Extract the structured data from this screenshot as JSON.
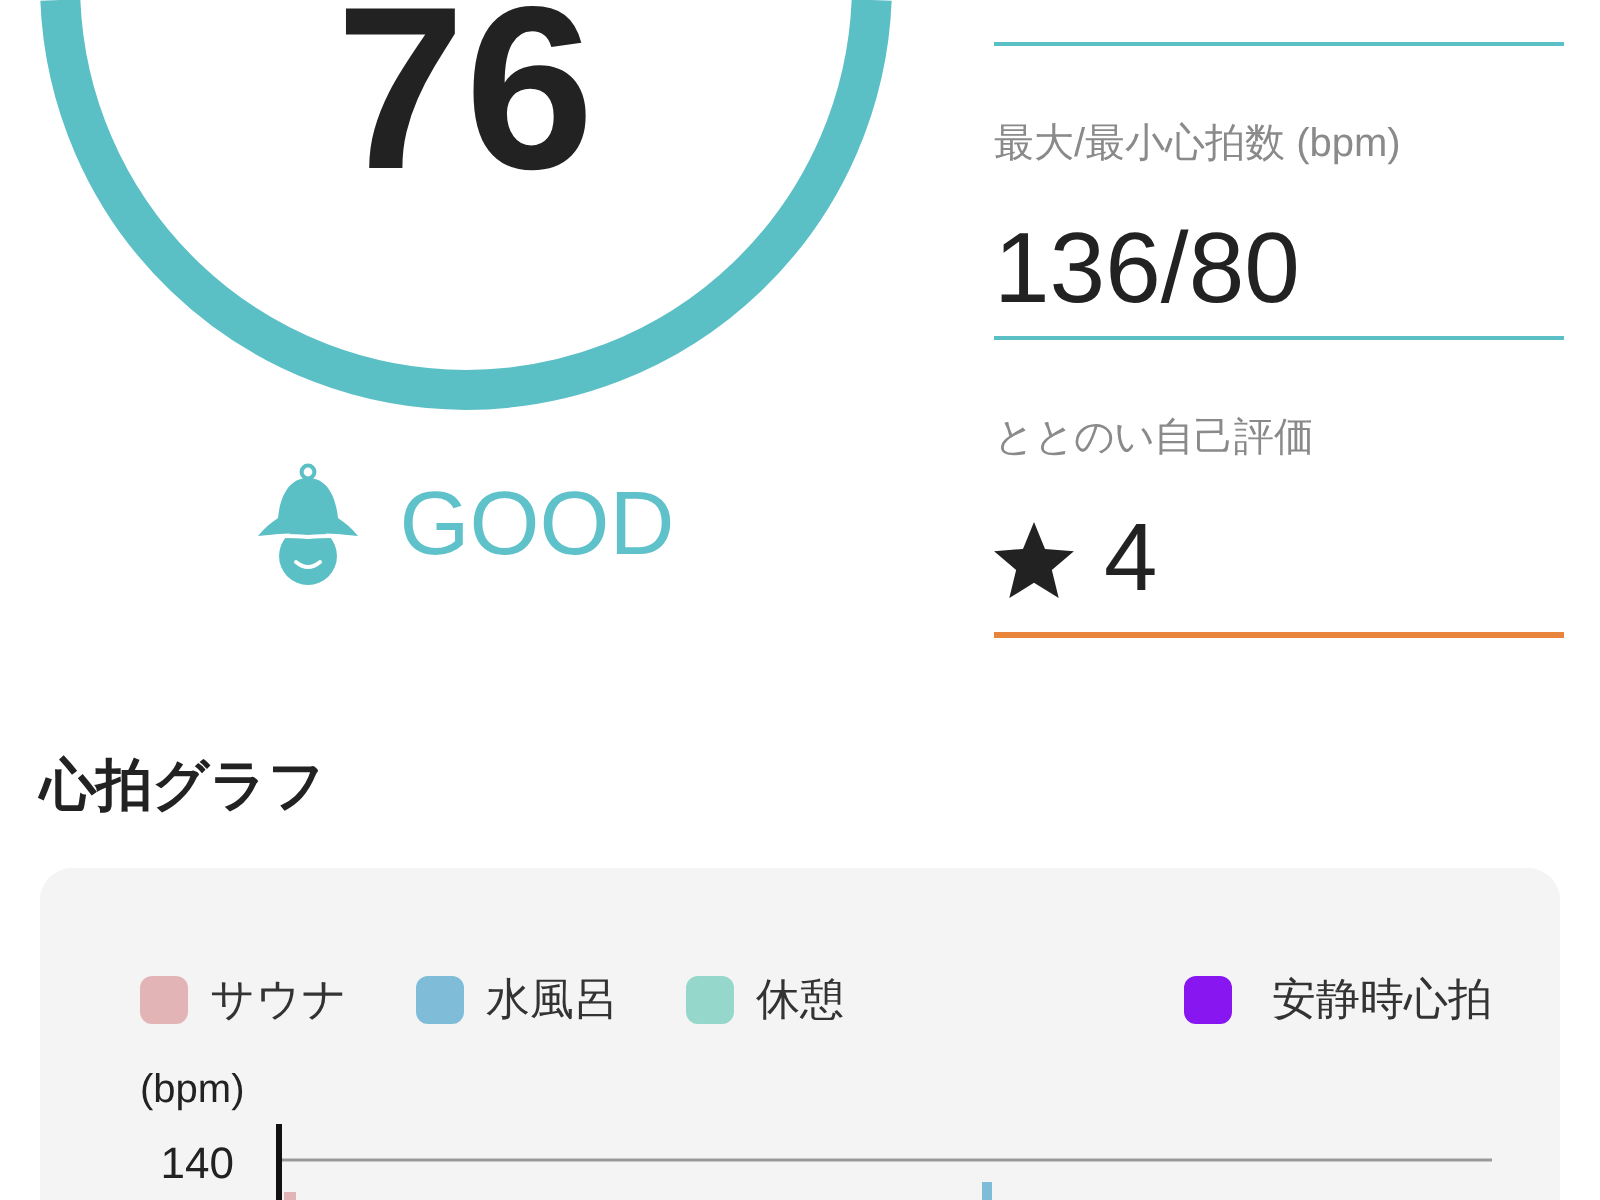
{
  "score": {
    "value": "76"
  },
  "status": {
    "label": "GOOD"
  },
  "stats": [
    {
      "kind": "value",
      "label": "最大/最小心拍数 (bpm)",
      "value": "136/80"
    },
    {
      "kind": "rating",
      "label": "ととのい自己評価",
      "value": "4"
    }
  ],
  "graph": {
    "title": "心拍グラフ",
    "legend": [
      {
        "kind": "phase",
        "label": "サウナ",
        "color": "#e3b4b6"
      },
      {
        "kind": "phase",
        "label": "水風呂",
        "color": "#7fbcd7"
      },
      {
        "kind": "phase",
        "label": "休憩",
        "color": "#95d7cb"
      },
      {
        "kind": "reference",
        "label": "安静時心拍",
        "color": "#8716f0"
      }
    ],
    "y_unit": "(bpm)",
    "y_ticks": [
      "140"
    ]
  }
}
